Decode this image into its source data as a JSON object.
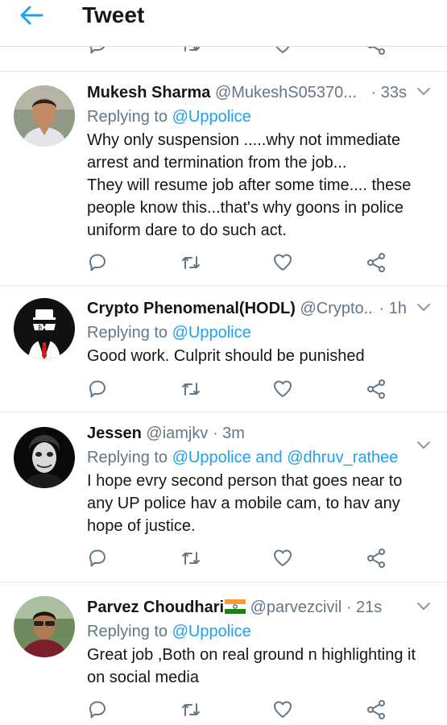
{
  "header": {
    "title": "Tweet",
    "back_icon": "back-arrow-icon"
  },
  "colors": {
    "accent": "#1da1f2",
    "muted": "#657786",
    "text": "#14171a"
  },
  "tweets": [
    {
      "name": "Mukesh Sharma",
      "handle": "@MukeshS05370...",
      "time": "· 33s",
      "reply_prefix": "Replying to",
      "reply_to": "@Uppolice",
      "lines": [
        "Why only suspension .....why not immediate",
        "arrest and termination from the job...",
        "They will resume job after some time.... these",
        "people know this...that's why goons in police",
        "uniform dare to do such act."
      ]
    },
    {
      "name": "Crypto Phenomenal(HODL)",
      "handle": "@Crypto...",
      "time": "· 1h",
      "reply_prefix": "Replying to",
      "reply_to": "@Uppolice",
      "lines": [
        "Good work. Culprit should be punished"
      ]
    },
    {
      "name": "Jessen",
      "handle": "@iamjkv",
      "time": "· 3m",
      "reply_prefix": "Replying to",
      "reply_to": "@Uppolice and @dhruv_rathee",
      "lines": [
        "I hope evry second person that goes near to",
        "any UP police hav a mobile cam, to hav any",
        "hope of justice."
      ]
    },
    {
      "name": "Parvez Choudhari",
      "name_flag": "🇮🇳",
      "handle": "@parvezcivil",
      "time": "· 21s",
      "reply_prefix": "Replying to",
      "reply_to": "@Uppolice",
      "lines": [
        "Great job ,Both on real ground n highlighting it",
        "on social media"
      ]
    }
  ]
}
